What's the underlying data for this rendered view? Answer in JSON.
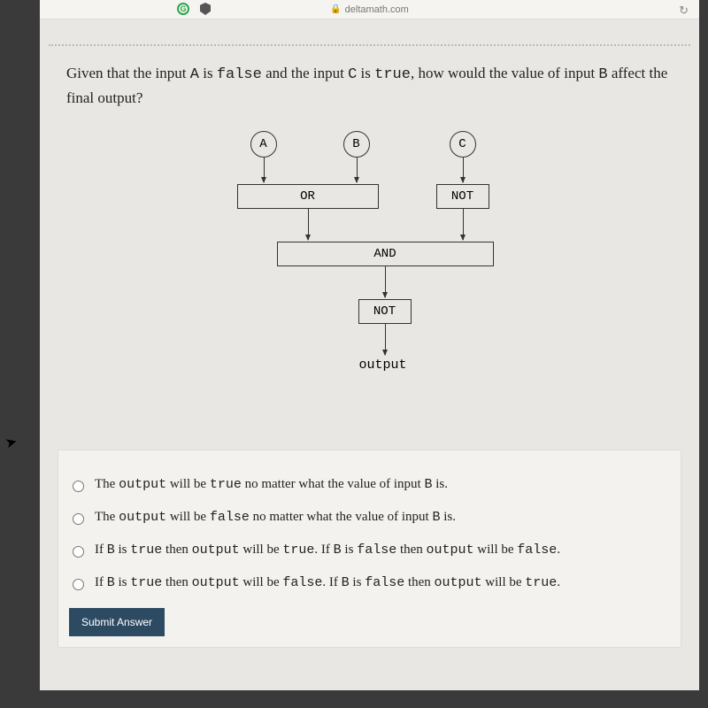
{
  "url": {
    "host": "deltamath.com"
  },
  "question": {
    "prefix": "Given that the input ",
    "a": "A",
    "mid1": " is ",
    "false": "false",
    "mid2": " and the input ",
    "c": "C",
    "mid3": " is ",
    "true": "true",
    "mid4": ", how would the value of input ",
    "b": "B",
    "suffix": " affect the final output?"
  },
  "diagram": {
    "inputA": "A",
    "inputB": "B",
    "inputC": "C",
    "gateOR": "OR",
    "gateNOT1": "NOT",
    "gateAND": "AND",
    "gateNOT2": "NOT",
    "output": "output"
  },
  "options": {
    "o1": {
      "p1": "The ",
      "m1": "output",
      "p2": " will be ",
      "m2": "true",
      "p3": " no matter what the value of input ",
      "m3": "B",
      "p4": " is."
    },
    "o2": {
      "p1": "The ",
      "m1": "output",
      "p2": " will be ",
      "m2": "false",
      "p3": " no matter what the value of input ",
      "m3": "B",
      "p4": " is."
    },
    "o3": {
      "p1": "If ",
      "m1": "B",
      "p2": " is ",
      "m2": "true",
      "p3": " then ",
      "m3": "output",
      "p4": " will be ",
      "m4": "true",
      "p5": ". If ",
      "m5": "B",
      "p6": " is ",
      "m6": "false",
      "p7": " then ",
      "m7": "output",
      "p8": " will be ",
      "m8": "false",
      "p9": "."
    },
    "o4": {
      "p1": "If ",
      "m1": "B",
      "p2": " is ",
      "m2": "true",
      "p3": " then ",
      "m3": "output",
      "p4": " will be ",
      "m4": "false",
      "p5": ". If ",
      "m5": "B",
      "p6": " is ",
      "m6": "false",
      "p7": " then ",
      "m7": "output",
      "p8": " will be ",
      "m8": "true",
      "p9": "."
    }
  },
  "submit": "Submit Answer"
}
